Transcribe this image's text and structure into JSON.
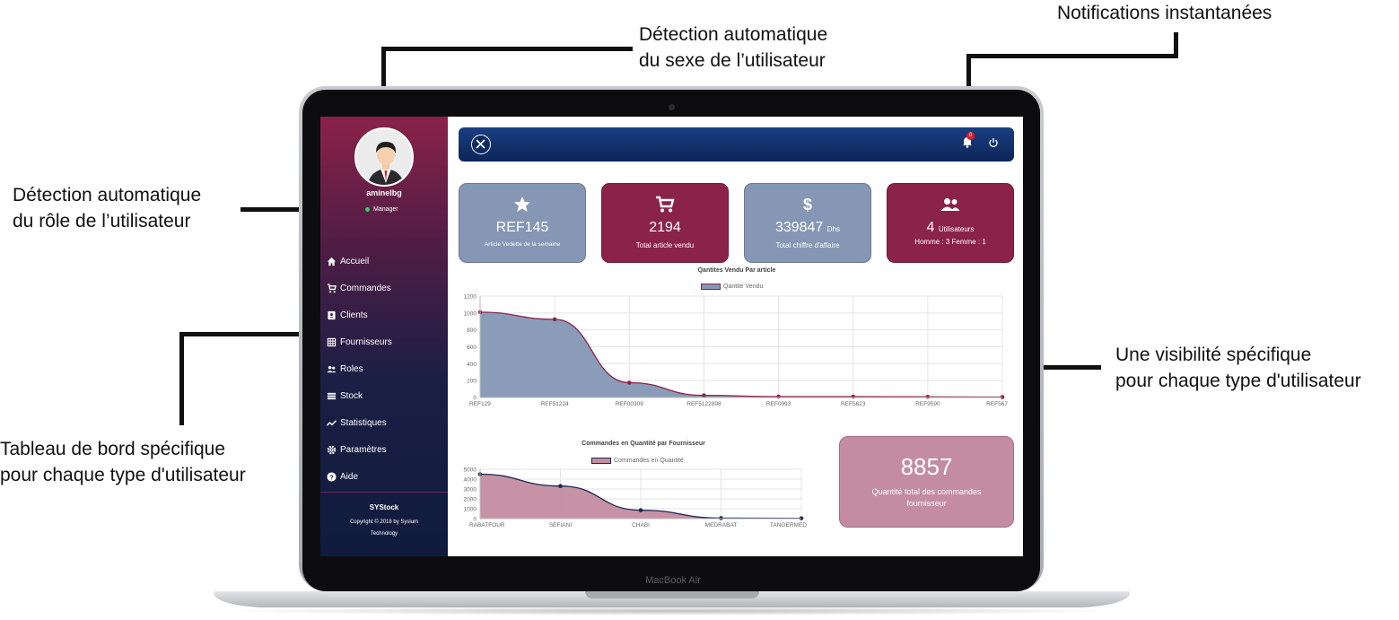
{
  "annotations": {
    "gender_line1": "Détection automatique",
    "gender_line2": "du sexe de l’utilisateur",
    "notifications": "Notifications instantanées",
    "role_line1": "Détection automatique",
    "role_line2": "du rôle de l’utilisateur",
    "visibility_line1": "Une visibilité spécifique",
    "visibility_line2": "pour chaque type d'utilisateur",
    "dashboard_line1": "Tableau de bord spécifique",
    "dashboard_line2": "pour chaque type d'utilisateur"
  },
  "device": {
    "brand": "MacBook Air"
  },
  "sidebar": {
    "username": "aminelbg",
    "role": "Manager",
    "items": [
      {
        "label": "Accueil",
        "icon": "home-icon"
      },
      {
        "label": "Commandes",
        "icon": "cart-icon"
      },
      {
        "label": "Clients",
        "icon": "contact-card-icon"
      },
      {
        "label": "Fournisseurs",
        "icon": "building-icon"
      },
      {
        "label": "Roles",
        "icon": "users-icon"
      },
      {
        "label": "Stock",
        "icon": "list-icon"
      },
      {
        "label": "Statistiques",
        "icon": "trending-icon"
      },
      {
        "label": "Paramètres",
        "icon": "gear-icon"
      },
      {
        "label": "Aide",
        "icon": "help-icon"
      }
    ],
    "footer_title": "SYStock",
    "footer_copy1": "Copyright © 2018 by Sysium",
    "footer_copy2": "Technology"
  },
  "topbar": {
    "notification_count": "0"
  },
  "cards": [
    {
      "value": "REF145",
      "label": "Article Vedette de la semaine",
      "icon": "star-icon",
      "color": "#8597b4"
    },
    {
      "value": "2194",
      "label": "Total article vendu",
      "icon": "cart-icon",
      "color": "#8b2249"
    },
    {
      "value": "339847",
      "unit": "Dhs",
      "label": "Total chiffre d'affaire",
      "icon": "dollar-icon",
      "color": "#8597b4"
    },
    {
      "value": "4",
      "unit": "Utilisateurs",
      "label": "Homme : 3 Femme : 1",
      "icon": "users-icon",
      "color": "#8b2249"
    }
  ],
  "total_orders": {
    "value": "8857",
    "label": "Quantité total des commandes fournisseur"
  },
  "chart_data": [
    {
      "type": "area",
      "title": "Qantites Vendu Par article",
      "series": [
        {
          "name": "Qantite Vendu",
          "values": [
            1010,
            925,
            175,
            25,
            10,
            10,
            8,
            5
          ]
        }
      ],
      "categories": [
        "REF129",
        "REF51224",
        "REF00309",
        "REF5122898",
        "REF0993",
        "REF5623",
        "REF9590",
        "REF567"
      ],
      "yticks": [
        "1200",
        "1000",
        "800",
        "600",
        "400",
        "200",
        "0"
      ],
      "ylim": [
        0,
        1200
      ],
      "grid": true,
      "legend": "top",
      "colors": {
        "fill": "#8597b4",
        "line": "#8b2249"
      }
    },
    {
      "type": "area",
      "title": "Commandes en Quantité par Fournisseur",
      "series": [
        {
          "name": "Commandes en Quantité",
          "values": [
            4500,
            3300,
            850,
            50,
            30
          ]
        }
      ],
      "categories": [
        "RABATFOUR",
        "SEFIANI",
        "CHABI",
        "MEDRABAT",
        "TANGERMED"
      ],
      "yticks": [
        "5000",
        "4000",
        "3000",
        "2000",
        "1000",
        "0"
      ],
      "ylim": [
        0,
        5000
      ],
      "grid": true,
      "legend": "top",
      "colors": {
        "fill": "#c48ca1",
        "line": "#1a2a52"
      }
    }
  ]
}
